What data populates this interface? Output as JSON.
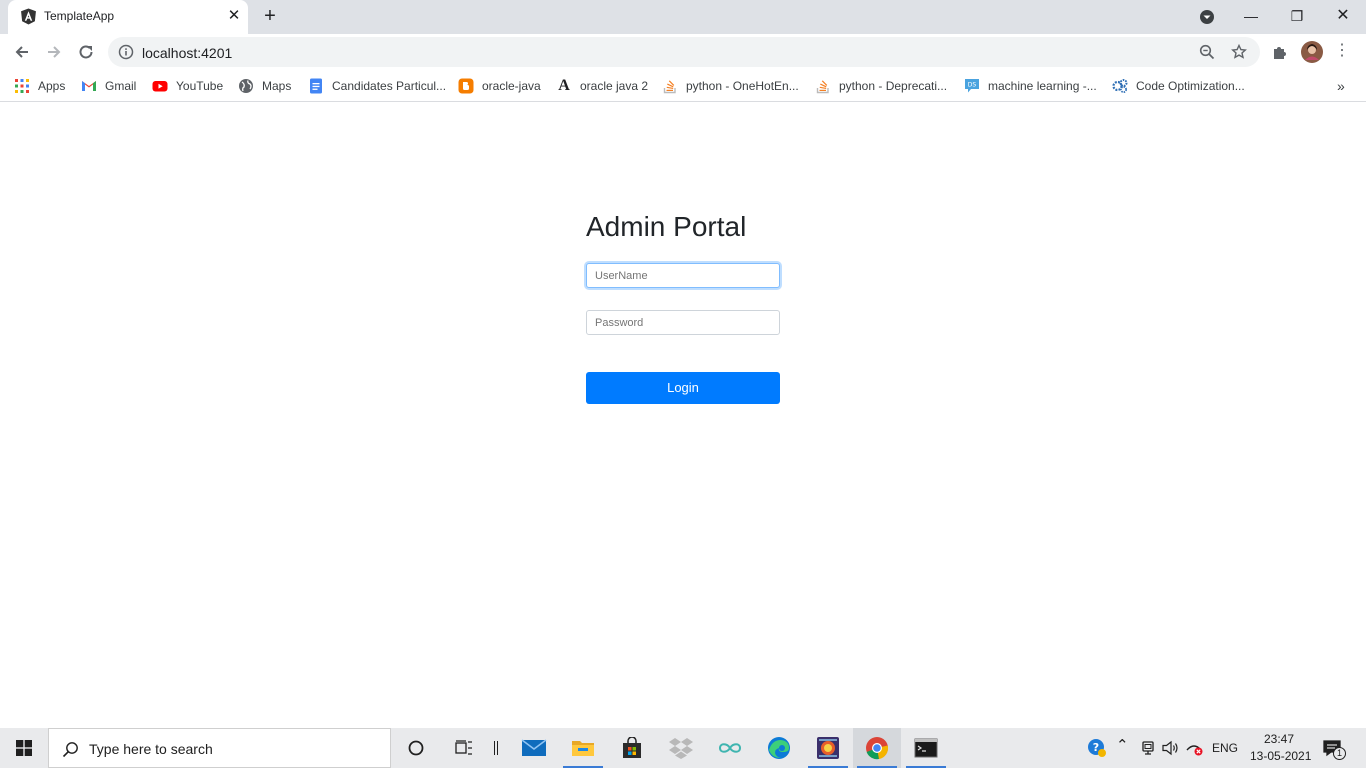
{
  "browser": {
    "tab_title": "TemplateApp",
    "tab_close": "✕",
    "new_tab": "+",
    "url": "localhost:4201",
    "window_controls": {
      "minimize": "—",
      "maximize": "❐",
      "close": "✕"
    },
    "bookmarks_overflow": "»"
  },
  "bookmarks": [
    {
      "label": "Apps",
      "icon": "apps-grid-icon"
    },
    {
      "label": "Gmail",
      "icon": "gmail-icon"
    },
    {
      "label": "YouTube",
      "icon": "youtube-icon"
    },
    {
      "label": "Maps",
      "icon": "maps-icon"
    },
    {
      "label": "Candidates Particul...",
      "icon": "docs-icon"
    },
    {
      "label": "oracle-java",
      "icon": "blogger-icon"
    },
    {
      "label": "oracle java 2",
      "icon": "letter-a-icon"
    },
    {
      "label": "python - OneHotEn...",
      "icon": "stackoverflow-icon"
    },
    {
      "label": "python - Deprecati...",
      "icon": "stackoverflow-icon"
    },
    {
      "label": "machine learning -...",
      "icon": "datascience-icon"
    },
    {
      "label": "Code Optimization...",
      "icon": "gear-cluster-icon"
    }
  ],
  "login": {
    "title": "Admin Portal",
    "username_placeholder": "UserName",
    "password_placeholder": "Password",
    "submit_label": "Login"
  },
  "taskbar": {
    "search_placeholder": "Type here to search",
    "language": "ENG",
    "time": "23:47",
    "date": "13-05-2021",
    "notification_count": "1"
  },
  "colors": {
    "primary": "#007bff",
    "tabstrip": "#dee1e6",
    "taskbar": "#e9eaec"
  }
}
